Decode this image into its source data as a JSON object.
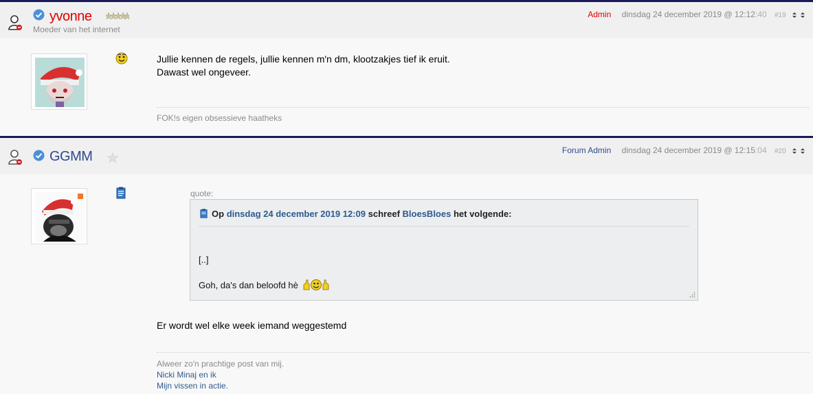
{
  "posts": [
    {
      "username": "yvonne",
      "user_title": "Moeder van het internet",
      "role": "Admin",
      "date": "dinsdag 24 december 2019 @ 12:12",
      "seconds": ":40",
      "post_number": "#19",
      "message_lines": [
        "Jullie kennen de regels, jullie kennen m'n dm, klootzakjes tief ik eruit.",
        "Dawast wel ongeveer."
      ],
      "signature": "FOK!s eigen obsessieve haatheks"
    },
    {
      "username": "GGMM",
      "user_title": "",
      "role": "Forum Admin",
      "date": "dinsdag 24 december 2019 @ 12:15",
      "seconds": ":04",
      "post_number": "#20",
      "quote": {
        "label": "quote:",
        "prefix": "Op",
        "date": "dinsdag 24 december 2019 12:09",
        "mid": "schreef",
        "author": "BloesBloes",
        "suffix": "het volgende:",
        "line1": "[..]",
        "line2": "Goh, da's dan beloofd hè"
      },
      "message": "Er wordt wel elke week iemand weggestemd",
      "signature_text": "Alweer zo'n prachtige post van mij.",
      "signature_links": [
        "Nicki Minaj en ik",
        "Mijn vissen in actie."
      ]
    }
  ],
  "colors": {
    "admin_red": "#e00000",
    "forum_admin_blue": "#2e4a8f",
    "link_blue": "#2e5a8f",
    "header_border": "#1a1a5a"
  },
  "icons": [
    "user-icon",
    "verified-badge-icon",
    "rank-stars-icon",
    "rank-star-icon",
    "smiley-icon",
    "clipboard-icon",
    "thumbs-up-smiley-icon",
    "sort-arrows-icon",
    "resize-grip-icon"
  ]
}
